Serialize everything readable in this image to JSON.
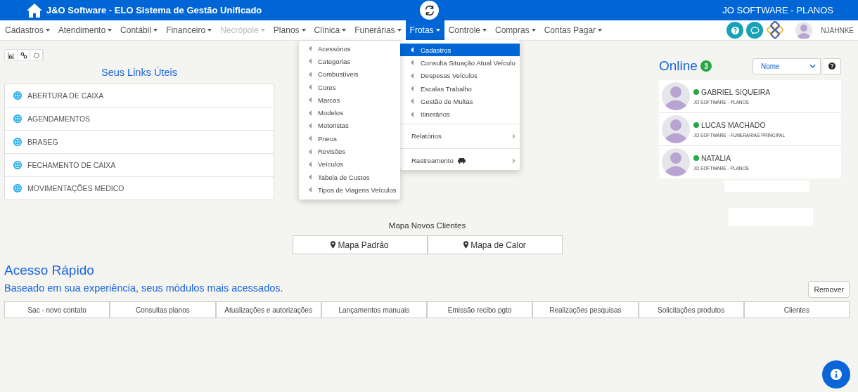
{
  "header": {
    "title": "J&O Software - ELO Sistema de Gestão Unificado",
    "company": "JO SOFTWARE - PLANOS"
  },
  "nav": [
    {
      "label": "Cadastros",
      "selected": false,
      "disabled": false
    },
    {
      "label": "Atendimento",
      "selected": false,
      "disabled": false
    },
    {
      "label": "Contábil",
      "selected": false,
      "disabled": false
    },
    {
      "label": "Financeiro",
      "selected": false,
      "disabled": false
    },
    {
      "label": "Necrópole",
      "selected": false,
      "disabled": true
    },
    {
      "label": "Planos",
      "selected": false,
      "disabled": false
    },
    {
      "label": "Clínica",
      "selected": false,
      "disabled": false
    },
    {
      "label": "Funerárias",
      "selected": false,
      "disabled": false
    },
    {
      "label": "Frotas",
      "selected": true,
      "disabled": false
    },
    {
      "label": "Controle",
      "selected": false,
      "disabled": false
    },
    {
      "label": "Compras",
      "selected": false,
      "disabled": false
    },
    {
      "label": "Contas Pagar",
      "selected": false,
      "disabled": false
    }
  ],
  "user": {
    "name": "NJAHNKE"
  },
  "frotas_menu": [
    {
      "label": "Cadastros",
      "kind": "item",
      "selected": true
    },
    {
      "label": "Consulta Situação Atual Veículo",
      "kind": "item",
      "selected": false
    },
    {
      "label": "Despesas Veículos",
      "kind": "item",
      "selected": false
    },
    {
      "label": "Escalas Trabalho",
      "kind": "item",
      "selected": false
    },
    {
      "label": "Gestão de Multas",
      "kind": "item",
      "selected": false
    },
    {
      "label": "Itinerários",
      "kind": "item",
      "selected": false
    },
    {
      "label": "Relatórios",
      "kind": "submenu",
      "selected": false
    },
    {
      "label": "Rastreamento",
      "kind": "submenu-vehicle",
      "selected": false
    }
  ],
  "cadastros_submenu": [
    "Acessórios",
    "Categorias",
    "Combustíveis",
    "Cores",
    "Marcas",
    "Modelos",
    "Motoristas",
    "Pneus",
    "Revisões",
    "Veículos",
    "Tabela de Custos",
    "Tipos de Viagens Veículos"
  ],
  "links": {
    "title": "Seus Links Úteis",
    "items": [
      "ABERTURA DE CAIXA",
      "AGENDAMENTOS",
      "BRASEG",
      "FECHAMENTO DE CAIXA",
      "MOVIMENTAÇÕES MEDICO"
    ]
  },
  "map": {
    "title": "Mapa Novos Clientes",
    "buttons": [
      "Mapa Padrão",
      "Mapa de Calor"
    ]
  },
  "online": {
    "title": "Online",
    "count": "3",
    "sort": "Nome",
    "users": [
      {
        "name": "GABRIEL SIQUEIRA",
        "company": "JO SOFTWARE - PLANOS",
        "color": "#28a745"
      },
      {
        "name": "LUCAS MACHADO",
        "company": "JO SOFTWARE - FUNERARIAS PRINCIPAL",
        "color": "#28a745"
      },
      {
        "name": "NATALIA",
        "company": "JO SOFTWARE - PLANOS",
        "color": "#28a745"
      }
    ]
  },
  "quick_access": {
    "title": "Acesso Rápido",
    "subtitle": "Baseado em sua experiência, seus módulos mais acessados.",
    "remove_button": "Remover",
    "items": [
      "Sac - novo contato",
      "Consultas planos",
      "Atualizações e autorizações",
      "Lançamentos manuais",
      "Emissão recibo pgto",
      "Realizações pesquisas",
      "Solicitações produtos",
      "Clientes"
    ]
  }
}
